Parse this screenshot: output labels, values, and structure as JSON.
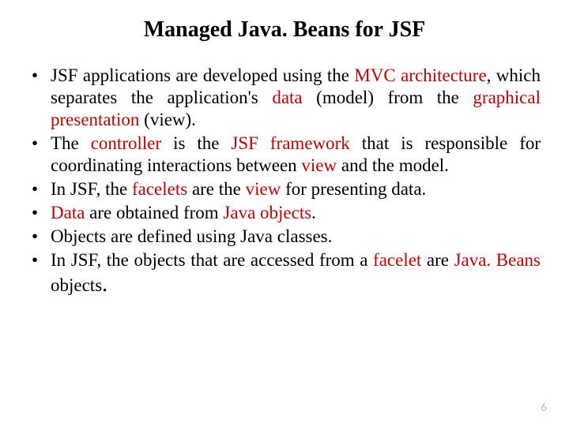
{
  "title": "Managed Java. Beans for JSF",
  "bullets": {
    "b0": {
      "p0": "JSF applications are developed using the ",
      "h0": "MVC architecture",
      "p1": ", which separates the application's ",
      "h1": "data",
      "p2": " (model) from the ",
      "h2": "graphical presentation",
      "p3": " (view)."
    },
    "b1": {
      "p0": "The ",
      "h0": "controller",
      "p1": " is the ",
      "h1": "JSF framework",
      "p2": " that is responsible for coordinating interactions between ",
      "h2": "view",
      "p3": " and the model."
    },
    "b2": {
      "p0": "In JSF, the ",
      "h0": "facelets",
      "p1": " are the ",
      "h1": "view",
      "p2": " for presenting data."
    },
    "b3": {
      "h0": "Data",
      "p1": " are obtained from ",
      "h1": "Java objects",
      "p2": "."
    },
    "b4": {
      "p0": "Objects are defined using Java classes."
    },
    "b5": {
      "p0": "In JSF, the objects that are accessed from a ",
      "h0": "facelet",
      "p1": " are ",
      "h1": "Java. Beans",
      "p2": " objects",
      "period": "."
    }
  },
  "page_number": "6"
}
